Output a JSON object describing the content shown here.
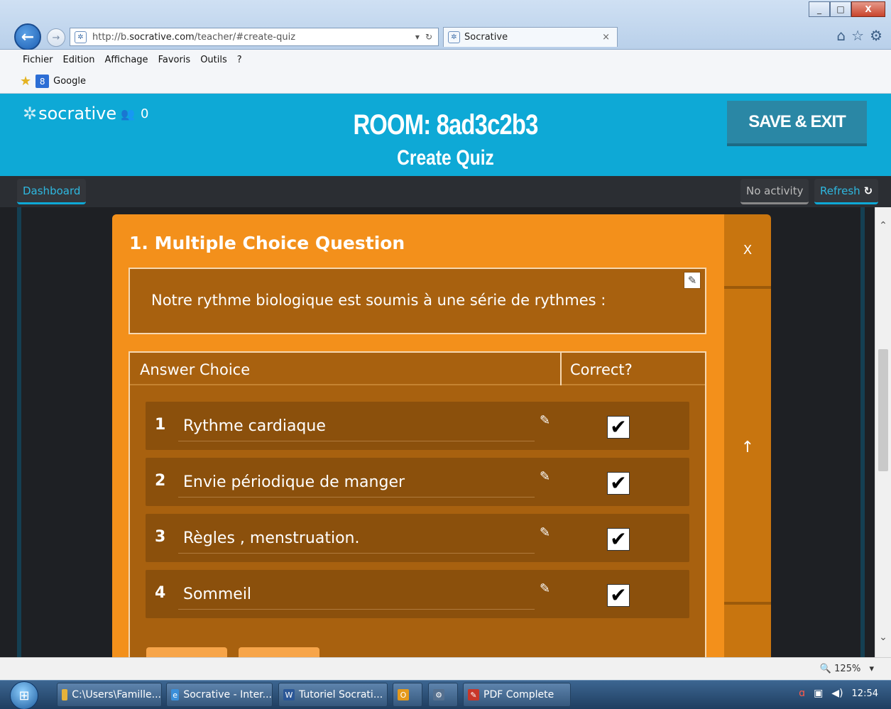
{
  "browser": {
    "url_prefix": "http://b.",
    "url_domain": "socrative.com",
    "url_path": "/teacher/#create-quiz",
    "tab_title": "Socrative",
    "tab_close": "×",
    "window_buttons": {
      "minimize": "_",
      "maximize": "□",
      "close": "X"
    },
    "menu": [
      "Fichier",
      "Edition",
      "Affichage",
      "Favoris",
      "Outils",
      "?"
    ],
    "favorites": [
      {
        "label": "Google",
        "icon": "google-icon"
      }
    ],
    "zoom_label": "125%"
  },
  "app": {
    "logo_text": "socrative",
    "student_count": "0",
    "room_title": "ROOM: 8ad3c2b3",
    "page_subtitle": "Create Quiz",
    "save_exit_label": "SAVE & EXIT",
    "nav": {
      "dashboard": "Dashboard",
      "no_activity": "No activity",
      "refresh": "Refresh"
    },
    "accent_color": "#0ea9d6",
    "card_color": "#f3901b"
  },
  "question": {
    "title": "1. Multiple Choice Question",
    "text": "Notre rythme biologique est soumis à une série de rythmes :",
    "close_label": "X",
    "move_up_label": "↑",
    "columns": {
      "answer": "Answer Choice",
      "correct": "Correct?"
    },
    "answers": [
      {
        "num": "1",
        "text": "Rythme cardiaque",
        "correct": true
      },
      {
        "num": "2",
        "text": "Envie périodique de manger",
        "correct": true
      },
      {
        "num": "3",
        "text": "Règles , menstruation.",
        "correct": true
      },
      {
        "num": "4",
        "text": "Sommeil",
        "correct": true
      }
    ]
  },
  "taskbar": {
    "items": [
      {
        "label": "C:\\Users\\Famille...",
        "icon": "folder-icon"
      },
      {
        "label": "Socrative - Inter...",
        "icon": "ie-icon"
      },
      {
        "label": "Tutoriel Socrati...",
        "icon": "word-icon"
      },
      {
        "label": "",
        "icon": "outlook-icon"
      },
      {
        "label": "",
        "icon": "app-icon"
      },
      {
        "label": "PDF Complete",
        "icon": "pdf-icon"
      }
    ],
    "clock": "12:54"
  }
}
